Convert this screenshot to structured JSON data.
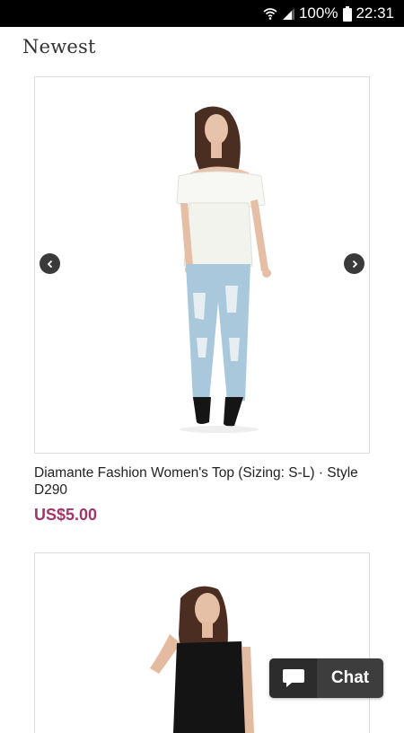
{
  "status_bar": {
    "battery": "100%",
    "time": "22:31",
    "icons": [
      "wifi-icon",
      "signal-icon",
      "battery-icon"
    ]
  },
  "page": {
    "title": "Newest"
  },
  "products": [
    {
      "title": "Diamante Fashion Women's Top (Sizing: S-L) · Style D290",
      "price": "US$5.00",
      "image": "model-white-off-shoulder-top-ripped-jeans",
      "nav": [
        "chevron-left-icon",
        "chevron-right-icon"
      ]
    },
    {
      "image": "model-black-sleeveless-top"
    }
  ],
  "chat": {
    "label": "Chat",
    "icon": "chat-bubble-icon"
  },
  "colors": {
    "price": "#a0366a",
    "status_bar": "#000000",
    "chat_bg": "#3d3d3d"
  }
}
